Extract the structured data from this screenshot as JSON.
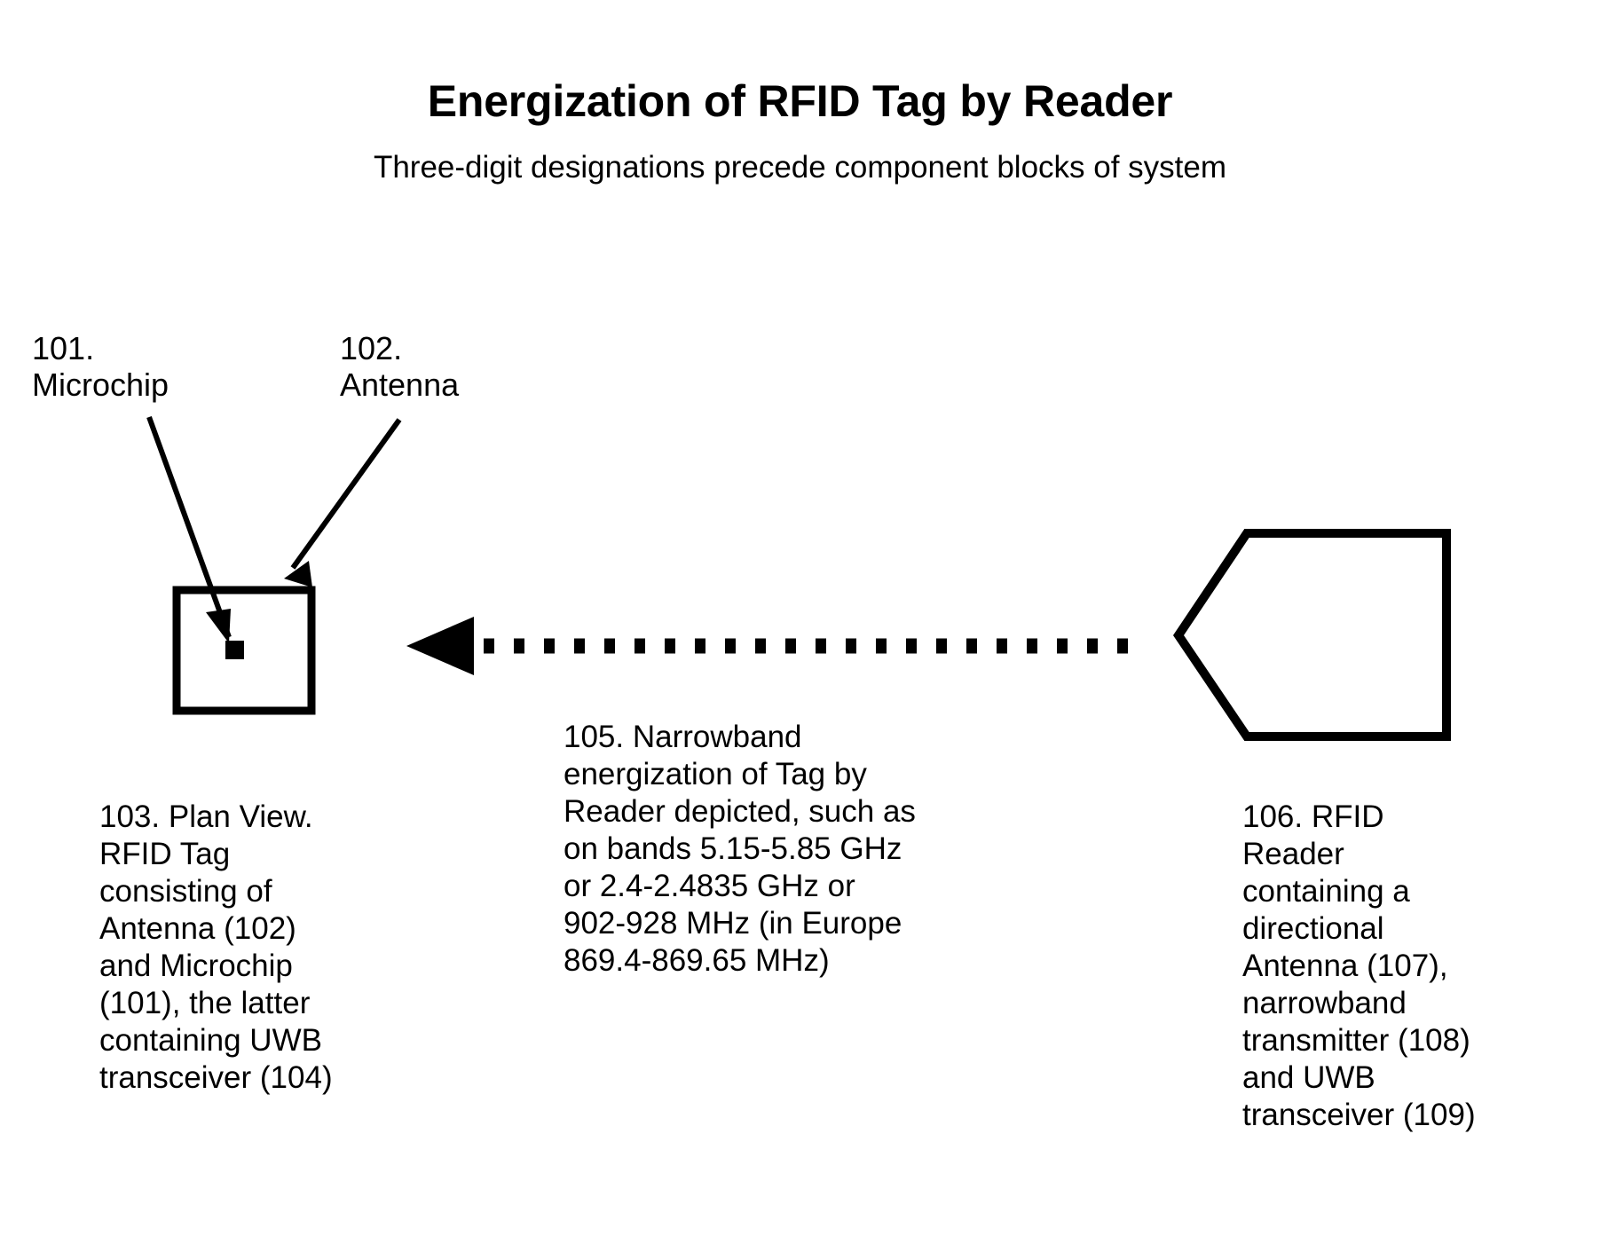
{
  "page": {
    "title": "Energization of RFID Tag by Reader",
    "subtitle": "Three-digit designations precede component blocks of system",
    "background_color": "#ffffff",
    "ink_color": "#000000"
  },
  "callouts": [
    {
      "id": "101",
      "name": "microchip-callout",
      "text": "101.\nMicrochip"
    },
    {
      "id": "102",
      "name": "antenna-callout",
      "text": "102.\nAntenna"
    }
  ],
  "shapes": {
    "tag_box": {
      "name": "rfid-tag-plan-view-box",
      "label": "RFID Tag plan view outline"
    },
    "microchip_square": {
      "name": "microchip-square",
      "label": "Microchip"
    },
    "reader_pentagon": {
      "name": "rfid-reader-shape",
      "label": "RFID Reader with directional antenna"
    },
    "signal_arrow": {
      "name": "narrowband-signal-arrow",
      "label": "Dotted arrow from Reader to Tag"
    }
  },
  "paragraphs": {
    "tag": {
      "id": "103",
      "text": "103. Plan View.\nRFID Tag\nconsisting of\nAntenna (102)\nand Microchip\n(101), the latter\ncontaining UWB\ntransceiver (104)"
    },
    "signal": {
      "id": "105",
      "text": "105. Narrowband\nenergization of Tag by\nReader depicted, such as\non bands  5.15-5.85 GHz\nor 2.4-2.4835 GHz or\n902-928 MHz (in Europe\n869.4-869.65 MHz)"
    },
    "reader": {
      "id": "106",
      "text": "106. RFID\nReader\ncontaining  a\ndirectional\nAntenna (107),\nnarrowband\ntransmitter (108)\nand UWB\ntransceiver (109)"
    }
  }
}
